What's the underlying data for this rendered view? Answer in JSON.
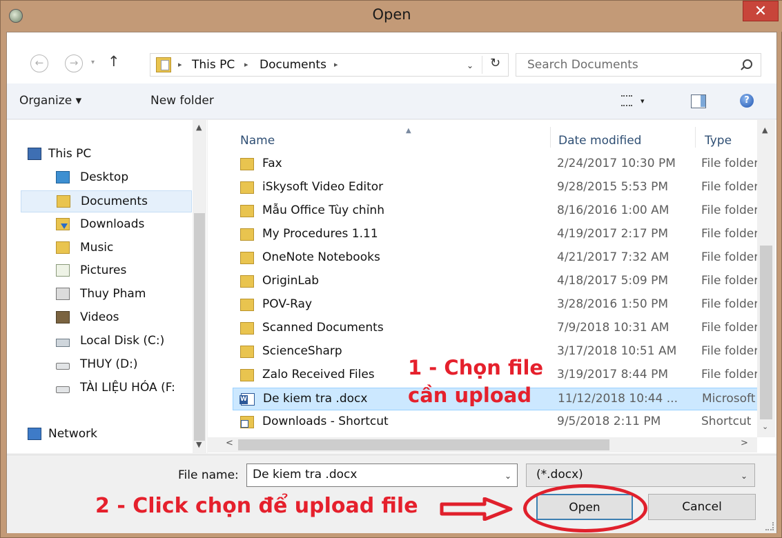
{
  "window": {
    "title": "Open",
    "close_label": "✕"
  },
  "nav": {
    "back_glyph": "←",
    "forward_glyph": "→",
    "dropdown_glyph": "▾",
    "up_glyph": "↑",
    "breadcrumb": [
      "This PC",
      "Documents"
    ],
    "breadcrumb_sep": "▸",
    "refresh_glyph": "↻",
    "address_dd_glyph": "⌄"
  },
  "search": {
    "placeholder": "Search Documents"
  },
  "toolbar": {
    "organize_label": "Organize ▾",
    "new_folder_label": "New folder",
    "view_dd_glyph": "▾",
    "help_label": "?"
  },
  "nav_pane": {
    "scroll_up": "▲",
    "scroll_down": "▼",
    "items": [
      {
        "label": "This PC",
        "icon": "computer-icon"
      },
      {
        "label": "Desktop",
        "icon": "desktop-icon"
      },
      {
        "label": "Documents",
        "icon": "documents-icon"
      },
      {
        "label": "Downloads",
        "icon": "downloads-icon"
      },
      {
        "label": "Music",
        "icon": "music-icon"
      },
      {
        "label": "Pictures",
        "icon": "pictures-icon"
      },
      {
        "label": "Thuy Pham",
        "icon": "user-icon"
      },
      {
        "label": "Videos",
        "icon": "videos-icon"
      },
      {
        "label": "Local Disk (C:)",
        "icon": "local-disk-icon"
      },
      {
        "label": "THUY (D:)",
        "icon": "drive-icon"
      },
      {
        "label": "TÀI LIỆU HÓA (F:",
        "icon": "drive-icon"
      },
      {
        "label": "Network",
        "icon": "network-icon"
      }
    ]
  },
  "file_list": {
    "columns": {
      "name": "Name",
      "date": "Date modified",
      "type": "Type"
    },
    "sort_glyph": "▲",
    "rows": [
      {
        "name": "Fax",
        "date": "2/24/2017 10:30 PM",
        "type": "File folder",
        "icon": "folder-icon"
      },
      {
        "name": "iSkysoft Video Editor",
        "date": "9/28/2015 5:53 PM",
        "type": "File folder",
        "icon": "folder-icon"
      },
      {
        "name": "Mẫu Office Tùy chỉnh",
        "date": "8/16/2016 1:00 AM",
        "type": "File folder",
        "icon": "folder-icon"
      },
      {
        "name": "My Procedures 1.11",
        "date": "4/19/2017 2:17 PM",
        "type": "File folder",
        "icon": "folder-icon"
      },
      {
        "name": "OneNote Notebooks",
        "date": "4/21/2017 7:32 AM",
        "type": "File folder",
        "icon": "folder-icon"
      },
      {
        "name": "OriginLab",
        "date": "4/18/2017 5:09 PM",
        "type": "File folder",
        "icon": "folder-icon"
      },
      {
        "name": "POV-Ray",
        "date": "3/28/2016 1:50 PM",
        "type": "File folder",
        "icon": "folder-icon"
      },
      {
        "name": "Scanned Documents",
        "date": "7/9/2018 10:31 AM",
        "type": "File folder",
        "icon": "folder-icon"
      },
      {
        "name": "ScienceSharp",
        "date": "3/17/2018 10:51 AM",
        "type": "File folder",
        "icon": "folder-icon"
      },
      {
        "name": "Zalo Received Files",
        "date": "3/19/2017 8:44 PM",
        "type": "File folder",
        "icon": "folder-icon"
      },
      {
        "name": "De kiem tra .docx",
        "date": "11/12/2018 10:44 ...",
        "type": "Microsoft",
        "icon": "word-doc-icon"
      },
      {
        "name": "Downloads - Shortcut",
        "date": "9/5/2018 2:11 PM",
        "type": "Shortcut",
        "icon": "shortcut-icon"
      }
    ],
    "scroll_up": "▲",
    "scroll_down": "⌄",
    "scroll_left": "<",
    "scroll_right": ">"
  },
  "annotations": {
    "step1_line1": "1 - Chọn file",
    "step1_line2": "cần upload",
    "step2": "2 - Click chọn để upload file",
    "color": "#e5202c"
  },
  "bottom": {
    "file_name_label": "File name:",
    "file_name_value": "De kiem tra .docx",
    "file_type_value": "(*.docx)",
    "dd_glyph": "⌄",
    "open_label": "Open",
    "cancel_label": "Cancel"
  }
}
